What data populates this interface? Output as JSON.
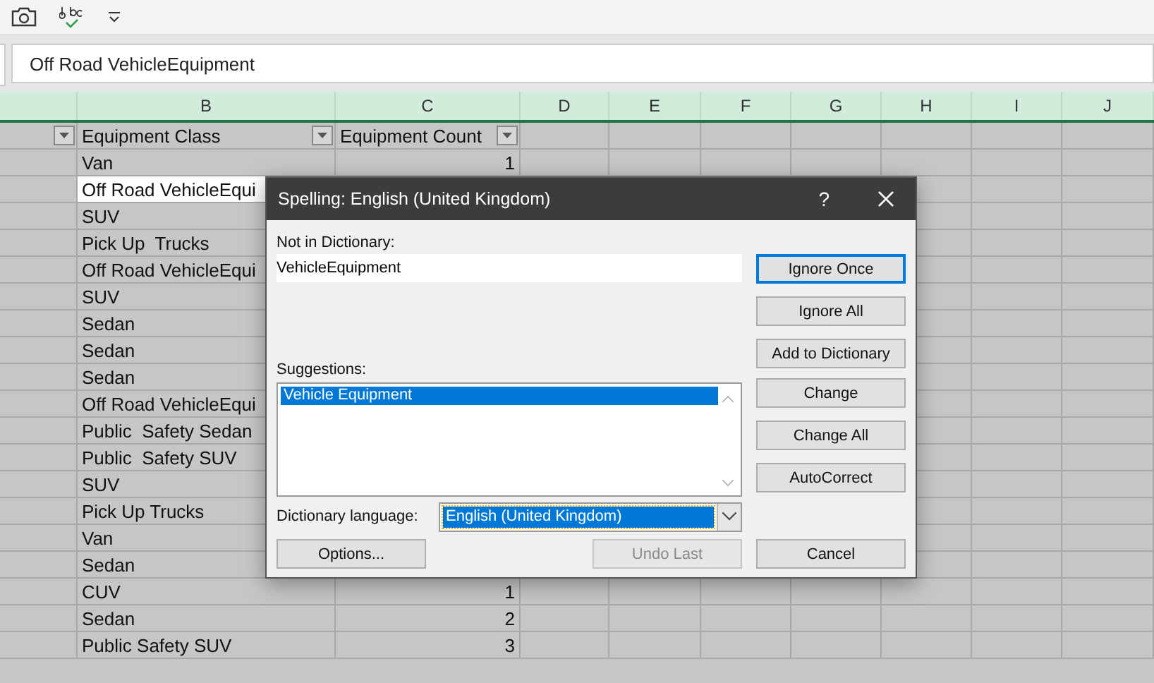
{
  "formula_bar": {
    "value": "Off Road VehicleEquipment"
  },
  "column_headers": [
    "B",
    "C",
    "D",
    "E",
    "F",
    "G",
    "H",
    "I",
    "J"
  ],
  "table": {
    "header": [
      "Equipment Class",
      "Equipment Count"
    ],
    "rows": [
      {
        "class": "Van",
        "count": "1",
        "selected": false
      },
      {
        "class": "Off Road VehicleEqui",
        "selected": true
      },
      {
        "class": "SUV",
        "selected": false
      },
      {
        "class": "Pick Up  Trucks",
        "selected": false
      },
      {
        "class": "Off Road VehicleEqui",
        "selected": false
      },
      {
        "class": "SUV",
        "selected": false
      },
      {
        "class": "Sedan",
        "selected": false
      },
      {
        "class": "Sedan",
        "selected": false
      },
      {
        "class": "Sedan",
        "selected": false
      },
      {
        "class": "Off Road VehicleEqui",
        "selected": false
      },
      {
        "class": "Public  Safety Sedan",
        "selected": false
      },
      {
        "class": "Public  Safety SUV",
        "selected": false
      },
      {
        "class": "SUV",
        "selected": false
      },
      {
        "class": "Pick Up Trucks",
        "selected": false
      },
      {
        "class": "Van",
        "selected": false
      },
      {
        "class": "Sedan",
        "selected": false
      },
      {
        "class": "CUV",
        "count": "1",
        "selected": false
      },
      {
        "class": "Sedan",
        "count": "2",
        "selected": false
      },
      {
        "class": "Public Safety SUV",
        "count": "3",
        "selected": false
      }
    ]
  },
  "dialog": {
    "title": "Spelling: English (United Kingdom)",
    "help": "?",
    "not_in_dictionary_label": "Not in Dictionary:",
    "not_in_dictionary_value": "VehicleEquipment",
    "suggestions_label": "Suggestions:",
    "suggestions": [
      {
        "text": "Vehicle Equipment",
        "selected": true
      }
    ],
    "language_label": "Dictionary language:",
    "language_value": "English (United Kingdom)",
    "side_buttons": [
      {
        "label": "Ignore Once",
        "focused": true,
        "disabled": false
      },
      {
        "label": "Ignore All",
        "focused": false,
        "disabled": false
      },
      {
        "label": "Add to Dictionary",
        "focused": false,
        "disabled": false
      },
      {
        "label": "Change",
        "focused": false,
        "disabled": false
      },
      {
        "label": "Change All",
        "focused": false,
        "disabled": false
      },
      {
        "label": "AutoCorrect",
        "focused": false,
        "disabled": false
      }
    ],
    "bottom_buttons": [
      {
        "label": "Options...",
        "focused": false,
        "disabled": false
      },
      {
        "label": "Undo Last",
        "focused": false,
        "disabled": true
      },
      {
        "label": "Cancel",
        "focused": false,
        "disabled": false
      }
    ]
  }
}
